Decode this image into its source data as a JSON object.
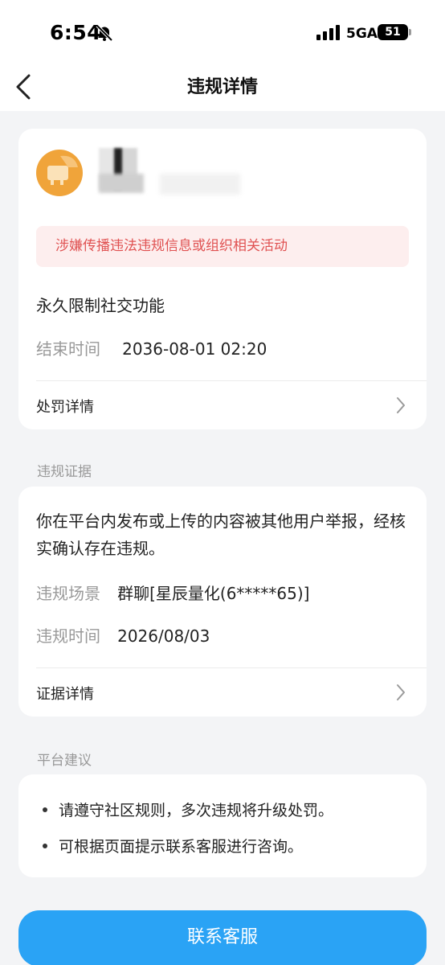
{
  "status_bar": {
    "time": "6:54",
    "network": "5GA",
    "battery": "51"
  },
  "nav": {
    "title": "违规详情"
  },
  "penalty_card": {
    "warning": "涉嫌传播违法违规信息或组织相关活动",
    "penalty": "永久限制社交功能",
    "end_time_label": "结束时间",
    "end_time_value": "2036-08-01 02:20",
    "details_link": "处罚详情"
  },
  "evidence": {
    "section_title": "违规证据",
    "description": "你在平台内发布或上传的内容被其他用户举报，经核实确认存在违规。",
    "scene_label": "违规场景",
    "scene_value": "群聊[星辰量化(6*****65)]",
    "time_label": "违规时间",
    "time_value": "2026/08/03",
    "details_link": "证据详情"
  },
  "advice": {
    "section_title": "平台建议",
    "tips": [
      "请遵守社区规则，多次违规将升级处罚。",
      "可根据页面提示联系客服进行咨询。"
    ]
  },
  "contact_button": "联系客服",
  "colors": {
    "accent": "#2aa3f5",
    "warning_text": "#e05252",
    "warning_bg": "#fdeeee",
    "avatar": "#f0a43a"
  }
}
